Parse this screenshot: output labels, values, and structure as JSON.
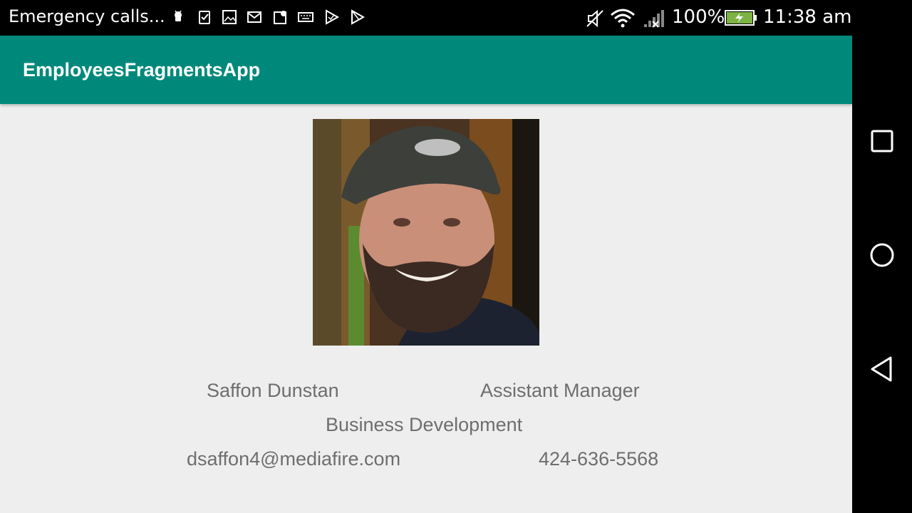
{
  "status_bar": {
    "carrier_text": "Emergency calls...",
    "notification_icons": [
      "android-icon",
      "task-check-icon",
      "image-icon",
      "gmail-icon",
      "maps-icon",
      "keyboard-icon",
      "play-store-icon",
      "play-icon"
    ],
    "battery_percent": "100%",
    "time": "11:38 am",
    "battery_color": "#7cb342"
  },
  "app_bar": {
    "title": "EmployeesFragmentsApp",
    "color": "#00897b"
  },
  "employee": {
    "name": "Saffon Dunstan",
    "job_title": "Assistant Manager",
    "department": "Business Development",
    "email": "dsaffon4@mediafire.com",
    "phone": "424-636-5568"
  },
  "nav_bar": {
    "buttons": [
      "recents-icon",
      "home-icon",
      "back-icon"
    ]
  }
}
